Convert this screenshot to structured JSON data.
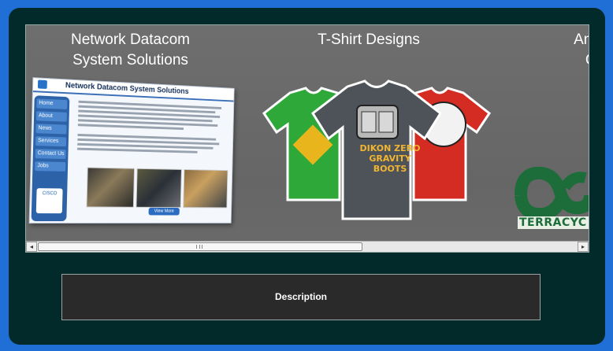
{
  "gallery": {
    "items": [
      {
        "caption": "Network Datacom\nSystem Solutions"
      },
      {
        "caption": "T-Shirt Designs"
      },
      {
        "caption": "Anima\nCa"
      }
    ],
    "site_mockup": {
      "title": "Network Datacom System Solutions",
      "nav": [
        "Home",
        "About",
        "News",
        "Services",
        "Contact Us",
        "Jobs"
      ],
      "badge": "CISCO",
      "more_button": "View More Photos"
    },
    "shirt_text": "DIKON ZERO\nGRAVITY BOOTS",
    "logo_text": "TERRACYC",
    "colors": {
      "green_shirt": "#2fa83a",
      "gray_shirt": "#4d5358",
      "red_shirt": "#d42b22",
      "terracycle": "#1d6d3a"
    }
  },
  "scrollbar": {
    "left_arrow": "◂",
    "right_arrow": "▸"
  },
  "description": {
    "label": "Description"
  }
}
